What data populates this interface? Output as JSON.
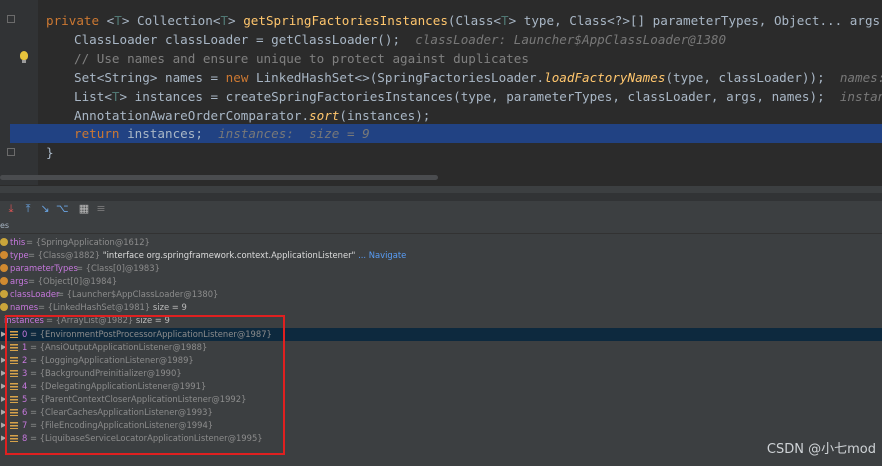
{
  "editor": {
    "line1": {
      "kw1": "private ",
      "t1": "<",
      "tparam": "T",
      "t2": "> Collection<",
      "tparam2": "T",
      "t3": "> ",
      "fn": "getSpringFactoriesInstances",
      "t4": "(Class<",
      "tparam3": "T",
      "t5": "> type, Class<?>[] parameterTypes, Object... args) {"
    },
    "line2": {
      "code": "ClassLoader classLoader = getClassLoader();",
      "hint": "classLoader: Launcher$AppClassLoader@1380"
    },
    "line3": {
      "comment": "// Use names and ensure unique to protect against duplicates"
    },
    "line4": {
      "t1": "Set<String> names = ",
      "kw": "new",
      "t2": " LinkedHashSet<>(SpringFactoriesLoader.",
      "sfn": "loadFactoryNames",
      "t3": "(type, classLoader));",
      "hint": "names:  s"
    },
    "line5": {
      "t1": "List<",
      "tparam": "T",
      "t2": "> instances = createSpringFactoriesInstances(type, parameterTypes, classLoader, args, names);",
      "hint": "instances"
    },
    "line6": {
      "t1": "AnnotationAwareOrderComparator.",
      "sfn": "sort",
      "t2": "(instances);"
    },
    "line7": {
      "kw": "return",
      "t1": " instances;",
      "hint": "instances:  size = 9"
    },
    "line8": {
      "t1": "}"
    }
  },
  "debugger": {
    "tabs_label": "es",
    "toolbar_icons": [
      "step-out-icon",
      "step-up-icon",
      "run-to-cursor-icon",
      "evaluate-icon",
      "table-icon",
      "list-icon"
    ],
    "variables": [
      {
        "name": "this",
        "value": "= {SpringApplication@1612}"
      },
      {
        "name": "type",
        "value": "= {Class@1882}",
        "extra": "\"interface org.springframework.context.ApplicationListener\"",
        "link": "... Navigate"
      },
      {
        "name": "parameterTypes",
        "value": "= {Class[0]@1983}"
      },
      {
        "name": "args",
        "value": "= {Object[0]@1984}"
      },
      {
        "name": "classLoader",
        "value": "= {Launcher$AppClassLoader@1380}"
      },
      {
        "name": "names",
        "value": "= {LinkedHashSet@1981}",
        "size": "size = 9"
      },
      {
        "name": "instances",
        "value": "= {ArrayList@1982}",
        "size": "size = 9"
      }
    ],
    "children": [
      {
        "index": "0",
        "value": "= {EnvironmentPostProcessorApplicationListener@1987}"
      },
      {
        "index": "1",
        "value": "= {AnsiOutputApplicationListener@1988}"
      },
      {
        "index": "2",
        "value": "= {LoggingApplicationListener@1989}"
      },
      {
        "index": "3",
        "value": "= {BackgroundPreinitializer@1990}"
      },
      {
        "index": "4",
        "value": "= {DelegatingApplicationListener@1991}"
      },
      {
        "index": "5",
        "value": "= {ParentContextCloserApplicationListener@1992}"
      },
      {
        "index": "6",
        "value": "= {ClearCachesApplicationListener@1993}"
      },
      {
        "index": "7",
        "value": "= {FileEncodingApplicationListener@1994}"
      },
      {
        "index": "8",
        "value": "= {LiquibaseServiceLocatorApplicationListener@1995}"
      }
    ]
  },
  "watermark": "CSDN @小七mod",
  "colors": {
    "accent_selection": "#214283",
    "annotation_box": "#e02020",
    "keyword": "#cc7832",
    "function": "#ffc66d"
  }
}
